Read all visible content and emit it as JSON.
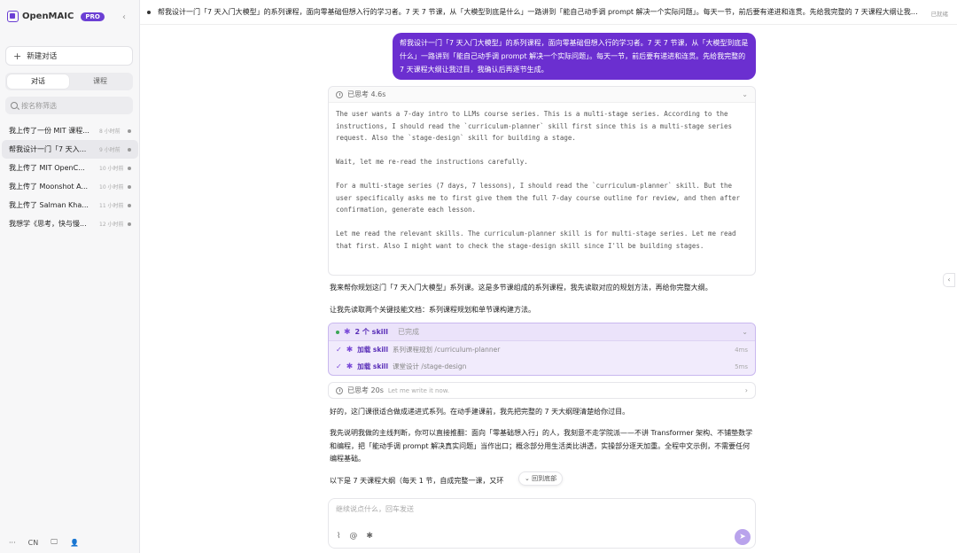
{
  "sidebar": {
    "brand": "OpenMAIC",
    "badge": "PRO",
    "collapse_icon": "‹",
    "new_chat": "新建对话",
    "tabs": [
      {
        "label": "对话",
        "active": true
      },
      {
        "label": "课程",
        "active": false
      }
    ],
    "search_placeholder": "按名称筛选",
    "conversations": [
      {
        "title": "我上传了一份 MIT 课程...",
        "time": "8 小时前",
        "active": false
      },
      {
        "title": "帮我设计一门「7 天入...",
        "time": "9 小时前",
        "active": true
      },
      {
        "title": "我上传了 MIT OpenC...",
        "time": "10 小时前",
        "active": false
      },
      {
        "title": "我上传了 Moonshot A...",
        "time": "10 小时前",
        "active": false
      },
      {
        "title": "我上传了 Salman Kha...",
        "time": "11 小时前",
        "active": false
      },
      {
        "title": "我想学《思考，快与慢...",
        "time": "12 小时前",
        "active": false
      }
    ],
    "footer": {
      "more": "···",
      "lang": "CN",
      "screen_icon": "🖵",
      "user_icon": "👤"
    }
  },
  "topbar": {
    "title": "帮我设计一门「7 天入门大模型」的系列课程，面向零基础但想入行的学习者。7 天 7 节课，从「大模型到底是什么」一路讲到「能自己动手调 prompt 解决一个实际问题」。每天一节，前后要有递进和连贯。先给我完整的 7 天课程大纲让我过目...",
    "status": "已就绪"
  },
  "user_message": "帮我设计一门「7 天入门大模型」的系列课程，面向零基础但想入行的学习者。7 天 7 节课，从「大模型到底是什么」一路讲到「能自己动手调 prompt 解决一个实际问题」。每天一节，前后要有递进和连贯。先给我完整的 7 天课程大纲让我过目，我确认后再逐节生成。",
  "thinking": {
    "label": "已思考 4.6s",
    "paragraphs": [
      "The user wants a 7-day intro to LLMs course series. This is a multi-stage series. According to the instructions, I should read the `curriculum-planner` skill first since this is a multi-stage series request. Also the `stage-design` skill for building a stage.",
      "Wait, let me re-read the instructions carefully.",
      "For a multi-stage series (7 days, 7 lessons), I should read the `curriculum-planner` skill. But the user specifically asks me to first give them the full 7-day course outline for review, and then after confirmation, generate each lesson.",
      "Let me read the relevant skills. The curriculum-planner skill is for multi-stage series. Let me read that first. Also I might want to check the stage-design skill since I'll be building stages."
    ]
  },
  "assistant": {
    "p1": "我来帮你规划这门「7 天入门大模型」系列课。这是多节课组成的系列课程，我先读取对应的规划方法，再给你完整大纲。",
    "p2": "让我先读取两个关键技能文档：系列课程规划和单节课构建方法。",
    "p3": "好的，这门课很适合做成递进式系列。在动手建课前，我先把完整的 7 天大纲理清楚给你过目。",
    "p4": "我先说明我做的主线判断，你可以直接推翻：面向「零基础想入行」的人，我刻意不走学院派——不讲 Transformer 架构、不铺垫数学和编程，把「能动手调 prompt 解决真实问题」当作出口；概念部分用生活类比讲透，实操部分逐天加重。全程中文示例，不需要任何编程基础。",
    "p5": "以下是 7 天课程大纲（每天 1 节，自成完整一课，又环"
  },
  "skills": {
    "count_label": "2 个 skill",
    "state": "已完成",
    "items": [
      {
        "action": "加载 skill",
        "desc": "系列课程规划 /curriculum-planner",
        "ms": "4ms"
      },
      {
        "action": "加载 skill",
        "desc": "课堂设计 /stage-design",
        "ms": "5ms"
      }
    ]
  },
  "thinking2": {
    "label": "已思考 20s",
    "sub": "Let me write it now."
  },
  "back_to_bottom": "⌄ 回到底部",
  "composer": {
    "placeholder": "继续说点什么，回车发送",
    "send_icon": "➤"
  },
  "colors": {
    "accent": "#6b2fd0",
    "skill_bg": "#f1ebfc",
    "sidebar_bg": "#f7f7f8"
  }
}
